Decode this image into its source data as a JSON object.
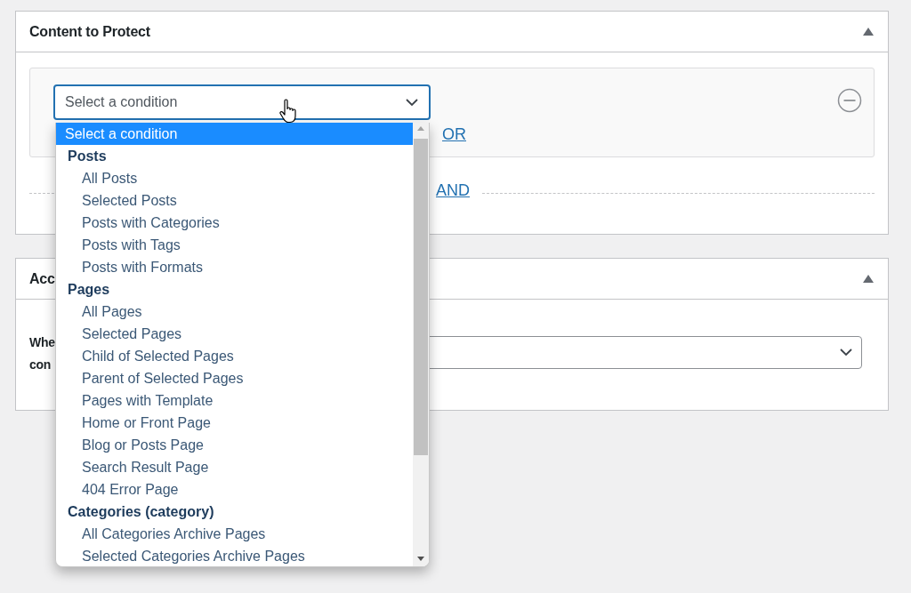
{
  "panels": [
    {
      "title": "Content to Protect",
      "expanded": true,
      "condition_select": {
        "value": "Select a condition",
        "open": true,
        "options": [
          {
            "kind": "option",
            "label": "Select a condition",
            "selected": true
          },
          {
            "kind": "group",
            "label": "Posts",
            "children": [
              {
                "label": "All Posts",
                "selected": false
              },
              {
                "label": "Selected Posts",
                "selected": false
              },
              {
                "label": "Posts with Categories",
                "selected": false
              },
              {
                "label": "Posts with Tags",
                "selected": false
              },
              {
                "label": "Posts with Formats",
                "selected": false
              }
            ]
          },
          {
            "kind": "group",
            "label": "Pages",
            "children": [
              {
                "label": "All Pages",
                "selected": false
              },
              {
                "label": "Selected Pages",
                "selected": false
              },
              {
                "label": "Child of Selected Pages",
                "selected": false
              },
              {
                "label": "Parent of Selected Pages",
                "selected": false
              },
              {
                "label": "Pages with Template",
                "selected": false
              },
              {
                "label": "Home or Front Page",
                "selected": false
              },
              {
                "label": "Blog or Posts Page",
                "selected": false
              },
              {
                "label": "Search Result Page",
                "selected": false
              },
              {
                "label": "404 Error Page",
                "selected": false
              }
            ]
          },
          {
            "kind": "group",
            "label": "Categories (category)",
            "children": [
              {
                "label": "All Categories Archive Pages",
                "selected": false
              },
              {
                "label": "Selected Categories Archive Pages",
                "selected": false
              }
            ]
          }
        ]
      },
      "or_link": "OR",
      "and_link": "AND"
    },
    {
      "title": "Acc",
      "expanded": true,
      "label_lines": [
        "Whe",
        "con"
      ]
    }
  ]
}
